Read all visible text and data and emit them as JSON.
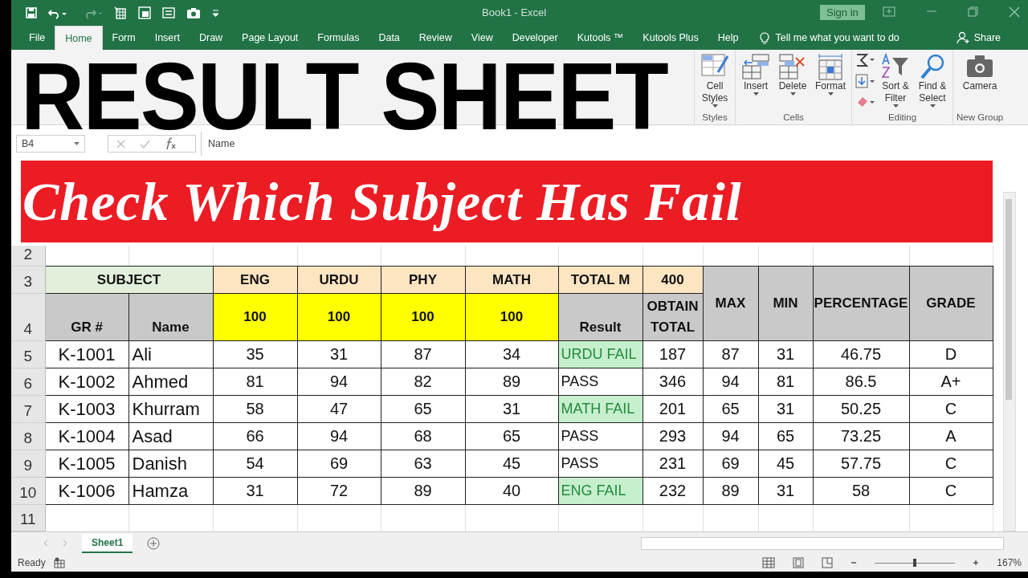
{
  "title_bar": {
    "document": "Book1 - Excel",
    "sign_in": "Sign in"
  },
  "menu_tabs": [
    {
      "label": "File",
      "selected": false
    },
    {
      "label": "Home",
      "selected": true
    },
    {
      "label": "Form",
      "selected": false
    },
    {
      "label": "Insert",
      "selected": false
    },
    {
      "label": "Draw",
      "selected": false
    },
    {
      "label": "Page Layout",
      "selected": false
    },
    {
      "label": "Formulas",
      "selected": false
    },
    {
      "label": "Data",
      "selected": false
    },
    {
      "label": "Review",
      "selected": false
    },
    {
      "label": "View",
      "selected": false
    },
    {
      "label": "Developer",
      "selected": false
    },
    {
      "label": "Kutools ™",
      "selected": false
    },
    {
      "label": "Kutools Plus",
      "selected": false
    },
    {
      "label": "Help",
      "selected": false
    }
  ],
  "tell_me": "Tell me what you want to do",
  "share": "Share",
  "ribbon_groups": [
    {
      "caption": "Styles",
      "buttons": [
        {
          "kind": "cellstyles",
          "label": "Cell Styles"
        }
      ]
    },
    {
      "caption": "Cells",
      "buttons": [
        {
          "kind": "insert",
          "label": "Insert"
        },
        {
          "kind": "delete",
          "label": "Delete"
        },
        {
          "kind": "format",
          "label": "Format"
        }
      ]
    },
    {
      "caption": "Editing",
      "buttons": [
        {
          "kind": "editstack"
        },
        {
          "kind": "sort",
          "label": "Sort & Filter"
        },
        {
          "kind": "find",
          "label": "Find & Select"
        }
      ]
    },
    {
      "caption": "New Group",
      "buttons": [
        {
          "kind": "camera",
          "label": "Camera"
        }
      ]
    }
  ],
  "formula_bar": {
    "name_box": "B4",
    "content": "Name"
  },
  "overlay": {
    "heading": "RESULT SHEET",
    "banner": "Check Which Subject Has Fail"
  },
  "sheet": {
    "row_numbers": [
      "2",
      "3",
      "4",
      "5",
      "6",
      "7",
      "8",
      "9",
      "10",
      "11"
    ],
    "subject_label": "SUBJECT",
    "subjects": [
      {
        "name": "ENG",
        "max": "100"
      },
      {
        "name": "URDU",
        "max": "100"
      },
      {
        "name": "PHY",
        "max": "100"
      },
      {
        "name": "MATH",
        "max": "100"
      }
    ],
    "total_label": "TOTAL M",
    "total_value": "400",
    "column_headers": {
      "gr": "GR #",
      "name": "Name",
      "result": "Result",
      "obtain": "OBTAIN TOTAL"
    },
    "stat_headers": [
      "MAX",
      "MIN",
      "PERCENTAGE",
      "GRADE"
    ],
    "rows": [
      {
        "gr": "K-1001",
        "name": "Ali",
        "marks": [
          "35",
          "31",
          "87",
          "34"
        ],
        "result": "URDU FAIL",
        "failed": true,
        "total": "187",
        "max": "87",
        "min": "31",
        "percentage": "46.75",
        "grade": "D"
      },
      {
        "gr": "K-1002",
        "name": "Ahmed",
        "marks": [
          "81",
          "94",
          "82",
          "89"
        ],
        "result": "PASS",
        "failed": false,
        "total": "346",
        "max": "94",
        "min": "81",
        "percentage": "86.5",
        "grade": "A+"
      },
      {
        "gr": "K-1003",
        "name": "Khurram",
        "marks": [
          "58",
          "47",
          "65",
          "31"
        ],
        "result": "MATH FAIL",
        "failed": true,
        "total": "201",
        "max": "65",
        "min": "31",
        "percentage": "50.25",
        "grade": "C"
      },
      {
        "gr": "K-1004",
        "name": "Asad",
        "marks": [
          "66",
          "94",
          "68",
          "65"
        ],
        "result": "PASS",
        "failed": false,
        "total": "293",
        "max": "94",
        "min": "65",
        "percentage": "73.25",
        "grade": "A"
      },
      {
        "gr": "K-1005",
        "name": "Danish",
        "marks": [
          "54",
          "69",
          "63",
          "45"
        ],
        "result": "PASS",
        "failed": false,
        "total": "231",
        "max": "69",
        "min": "45",
        "percentage": "57.75",
        "grade": "C"
      },
      {
        "gr": "K-1006",
        "name": "Hamza",
        "marks": [
          "31",
          "72",
          "89",
          "40"
        ],
        "result": "ENG FAIL",
        "failed": true,
        "total": "232",
        "max": "89",
        "min": "31",
        "percentage": "58",
        "grade": "C"
      }
    ]
  },
  "sheet_tabs": [
    {
      "label": "Sheet1",
      "selected": true
    }
  ],
  "status": {
    "text": "Ready",
    "zoom": "167%",
    "zoom_slider": {
      "level": 0.5
    }
  }
}
